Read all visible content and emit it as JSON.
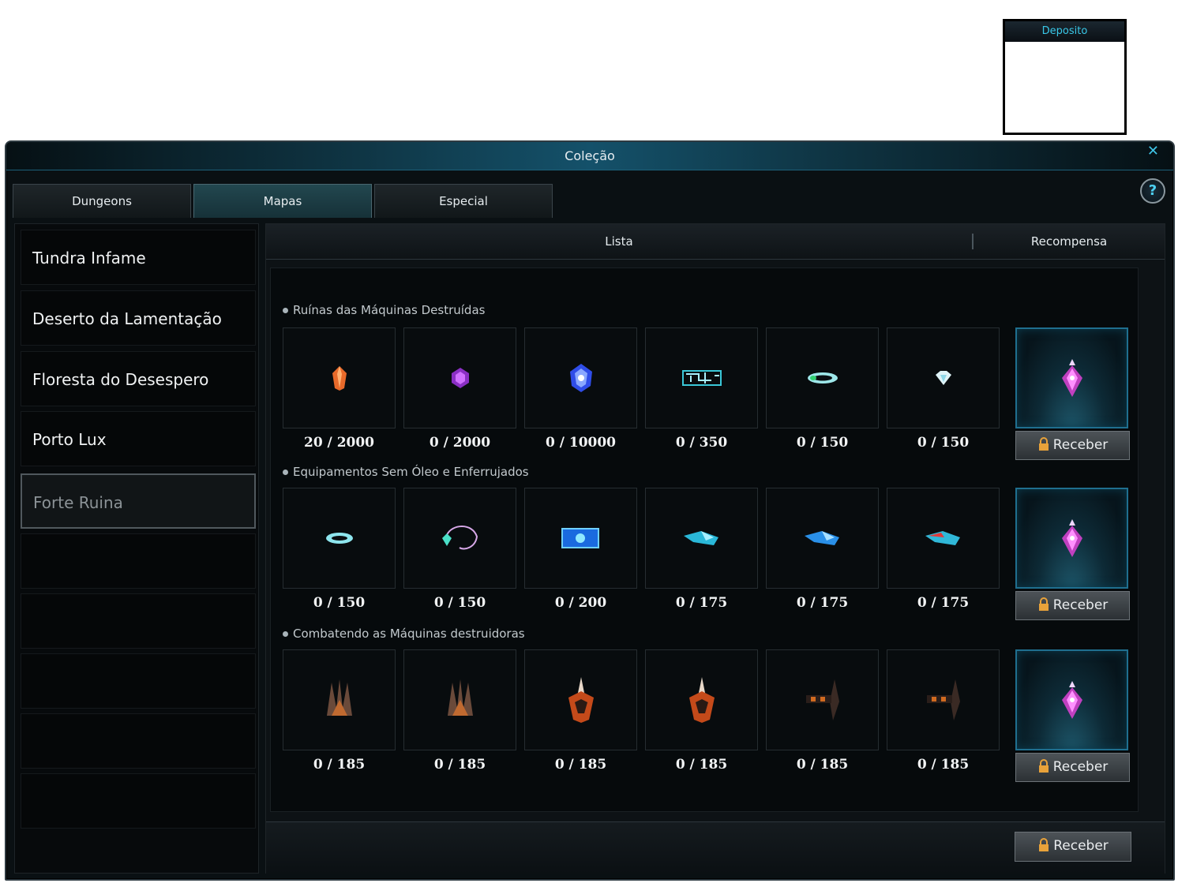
{
  "deposito": {
    "title": "Deposito"
  },
  "window": {
    "title": "Coleção"
  },
  "tabs": [
    {
      "label": "Dungeons"
    },
    {
      "label": "Mapas"
    },
    {
      "label": "Especial"
    }
  ],
  "regions": [
    {
      "label": "Tundra Infame"
    },
    {
      "label": "Deserto da Lamentação"
    },
    {
      "label": "Floresta do Desespero"
    },
    {
      "label": "Porto Lux"
    },
    {
      "label": "Forte Ruina"
    }
  ],
  "header": {
    "list_label": "Lista",
    "reward_label": "Recompensa"
  },
  "groups": [
    {
      "title": "Ruínas das Máquinas Destruídas",
      "items": [
        {
          "icon": "orange-crystal-icon",
          "count": "20 / 2000"
        },
        {
          "icon": "purple-gem-icon",
          "count": "0 / 2000"
        },
        {
          "icon": "blue-crystal-icon",
          "count": "0 / 10000"
        },
        {
          "icon": "circuit-part-icon",
          "count": "0 / 350"
        },
        {
          "icon": "ring-icon",
          "count": "0 / 150"
        },
        {
          "icon": "small-gem-icon",
          "count": "0 / 150"
        }
      ],
      "reward_button": "Receber"
    },
    {
      "title": "Equipamentos Sem Óleo e Enferrujados",
      "items": [
        {
          "icon": "ring-icon",
          "count": "0 / 150"
        },
        {
          "icon": "necklace-icon",
          "count": "0 / 150"
        },
        {
          "icon": "blue-card-icon",
          "count": "0 / 200"
        },
        {
          "icon": "blue-boots-icon",
          "count": "0 / 175"
        },
        {
          "icon": "blue-boots-icon",
          "count": "0 / 175"
        },
        {
          "icon": "red-boots-icon",
          "count": "0 / 175"
        }
      ],
      "reward_button": "Receber"
    },
    {
      "title": "Combatendo as Máquinas destruidoras",
      "items": [
        {
          "icon": "claw-armor-icon",
          "count": "0 / 185"
        },
        {
          "icon": "claw-armor-icon",
          "count": "0 / 185"
        },
        {
          "icon": "horned-mask-icon",
          "count": "0 / 185"
        },
        {
          "icon": "horned-mask-icon",
          "count": "0 / 185"
        },
        {
          "icon": "dark-weapon-icon",
          "count": "0 / 185"
        },
        {
          "icon": "dark-weapon-icon",
          "count": "0 / 185"
        }
      ],
      "reward_button": "Receber"
    }
  ],
  "footer": {
    "receive_all": "Receber"
  },
  "colors": {
    "accent": "#3fc4e6",
    "reward_border": "#1f6f8f"
  }
}
